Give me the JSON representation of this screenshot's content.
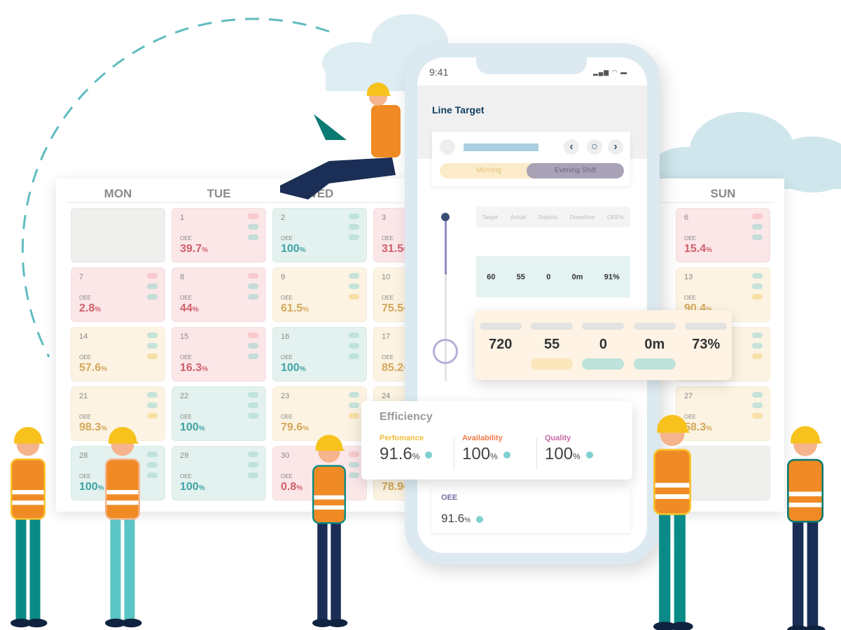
{
  "calendar": {
    "days": [
      "MON",
      "TUE",
      "WED",
      "SUN"
    ],
    "oee_label": "OEE",
    "columns": [
      [
        {
          "n": "",
          "t": "gray"
        },
        {
          "n": "7",
          "v": "2.8",
          "t": "red"
        },
        {
          "n": "14",
          "v": "57.6",
          "t": "yel"
        },
        {
          "n": "21",
          "v": "98.3",
          "t": "yel"
        },
        {
          "n": "28",
          "v": "100",
          "t": "teal"
        }
      ],
      [
        {
          "n": "1",
          "v": "39.7",
          "t": "red"
        },
        {
          "n": "8",
          "v": "44",
          "t": "red"
        },
        {
          "n": "15",
          "v": "16.3",
          "t": "red"
        },
        {
          "n": "22",
          "v": "100",
          "t": "teal"
        },
        {
          "n": "29",
          "v": "100",
          "t": "teal"
        }
      ],
      [
        {
          "n": "2",
          "v": "100",
          "t": "teal"
        },
        {
          "n": "9",
          "v": "61.5",
          "t": "yel"
        },
        {
          "n": "16",
          "v": "100",
          "t": "teal"
        },
        {
          "n": "23",
          "v": "79.6",
          "t": "yel"
        },
        {
          "n": "30",
          "v": "0.8",
          "t": "red"
        }
      ],
      [
        {
          "n": "3",
          "v": "31.5",
          "t": "red"
        },
        {
          "n": "10",
          "v": "75.5",
          "t": "yel"
        },
        {
          "n": "17",
          "v": "85.2",
          "t": "yel"
        },
        {
          "n": "24",
          "v": "",
          "t": "yel"
        },
        {
          "n": "",
          "v": "78.9",
          "t": "yel"
        }
      ],
      [
        {
          "n": "6",
          "v": "15.4",
          "t": "red"
        },
        {
          "n": "13",
          "v": "90.4",
          "t": "yel"
        },
        {
          "n": "",
          "v": "",
          "t": "yel"
        },
        {
          "n": "27",
          "v": "58.3",
          "t": "yel"
        },
        {
          "n": "",
          "t": "gray"
        }
      ]
    ],
    "percent": "%"
  },
  "phone": {
    "time": "9:41",
    "title": "Line Target",
    "shift_morning": "Morning",
    "shift_evening": "Evening Shift",
    "table_headers": [
      "Target",
      "Actual",
      "Rejects",
      "Downtime",
      "OEE%"
    ],
    "row1": [
      "60",
      "55",
      "0",
      "0m",
      "91%"
    ],
    "highlight_row": [
      "720",
      "55",
      "0",
      "0m",
      "73%"
    ],
    "oee_label": "OEE",
    "oee_value": "91.6",
    "percent": "%"
  },
  "efficiency": {
    "title": "Efficiency",
    "metrics": [
      {
        "label": "Perfomance",
        "value": "91.6",
        "color": "#f2be3b"
      },
      {
        "label": "Availability",
        "value": "100",
        "color": "#ec7b4b"
      },
      {
        "label": "Quality",
        "value": "100",
        "color": "#c86aa8"
      }
    ],
    "percent": "%"
  },
  "colors": {
    "accent_teal": "#7ecfd0",
    "title_navy": "#0e3d5f",
    "vest_orange": "#f08a24",
    "hat_yellow": "#f7c21c"
  }
}
